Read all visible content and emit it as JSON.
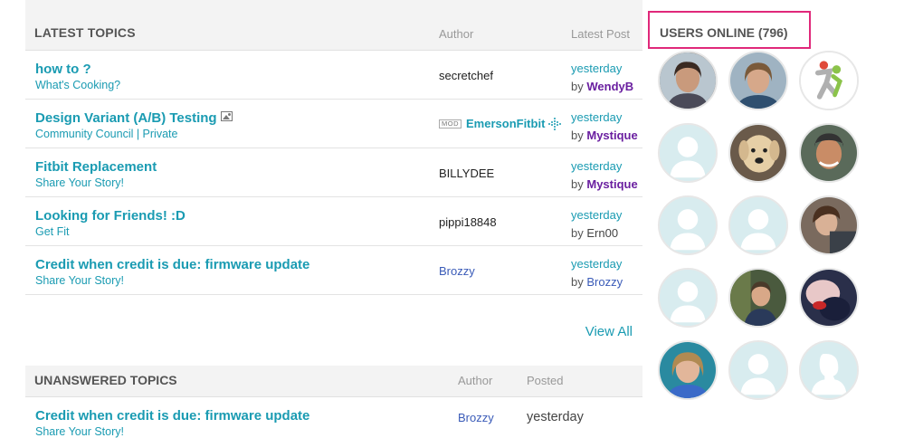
{
  "latest_topics": {
    "title": "LATEST TOPICS",
    "col_author": "Author",
    "col_latest": "Latest Post",
    "rows": [
      {
        "title": "how to ?",
        "board": "What's Cooking?",
        "author": "secretchef",
        "when": "yesterday",
        "by_prefix": "by",
        "by": "WendyB"
      },
      {
        "title": "Design Variant (A/B) Testing",
        "board": "Community Council | Private",
        "badge": "MOD",
        "author": "EmersonFitbit",
        "when": "yesterday",
        "by_prefix": "by",
        "by": "Mystique"
      },
      {
        "title": "Fitbit Replacement",
        "board": "Share Your Story!",
        "author": "BILLYDEE",
        "when": "yesterday",
        "by_prefix": "by",
        "by": "Mystique"
      },
      {
        "title": "Looking for Friends! :D",
        "board": "Get Fit",
        "author": "pippi18848",
        "when": "yesterday",
        "by_prefix": "by",
        "by": "Ern00"
      },
      {
        "title": "Credit when credit is due: firmware update",
        "board": "Share Your Story!",
        "author": "Brozzy",
        "when": "yesterday",
        "by_prefix": "by",
        "by": "Brozzy"
      }
    ],
    "view_all": "View All"
  },
  "unanswered_topics": {
    "title": "UNANSWERED TOPICS",
    "col_author": "Author",
    "col_posted": "Posted",
    "rows": [
      {
        "title": "Credit when credit is due: firmware update",
        "board": "Share Your Story!",
        "author": "Brozzy",
        "posted": "yesterday"
      }
    ]
  },
  "users_online": {
    "title": "USERS ONLINE (796)"
  },
  "colors": {
    "accent_teal": "#1a9bb2",
    "user_purple": "#6a1fa0",
    "link_blue": "#3a5bb8",
    "highlight_pink": "#e0287a"
  }
}
